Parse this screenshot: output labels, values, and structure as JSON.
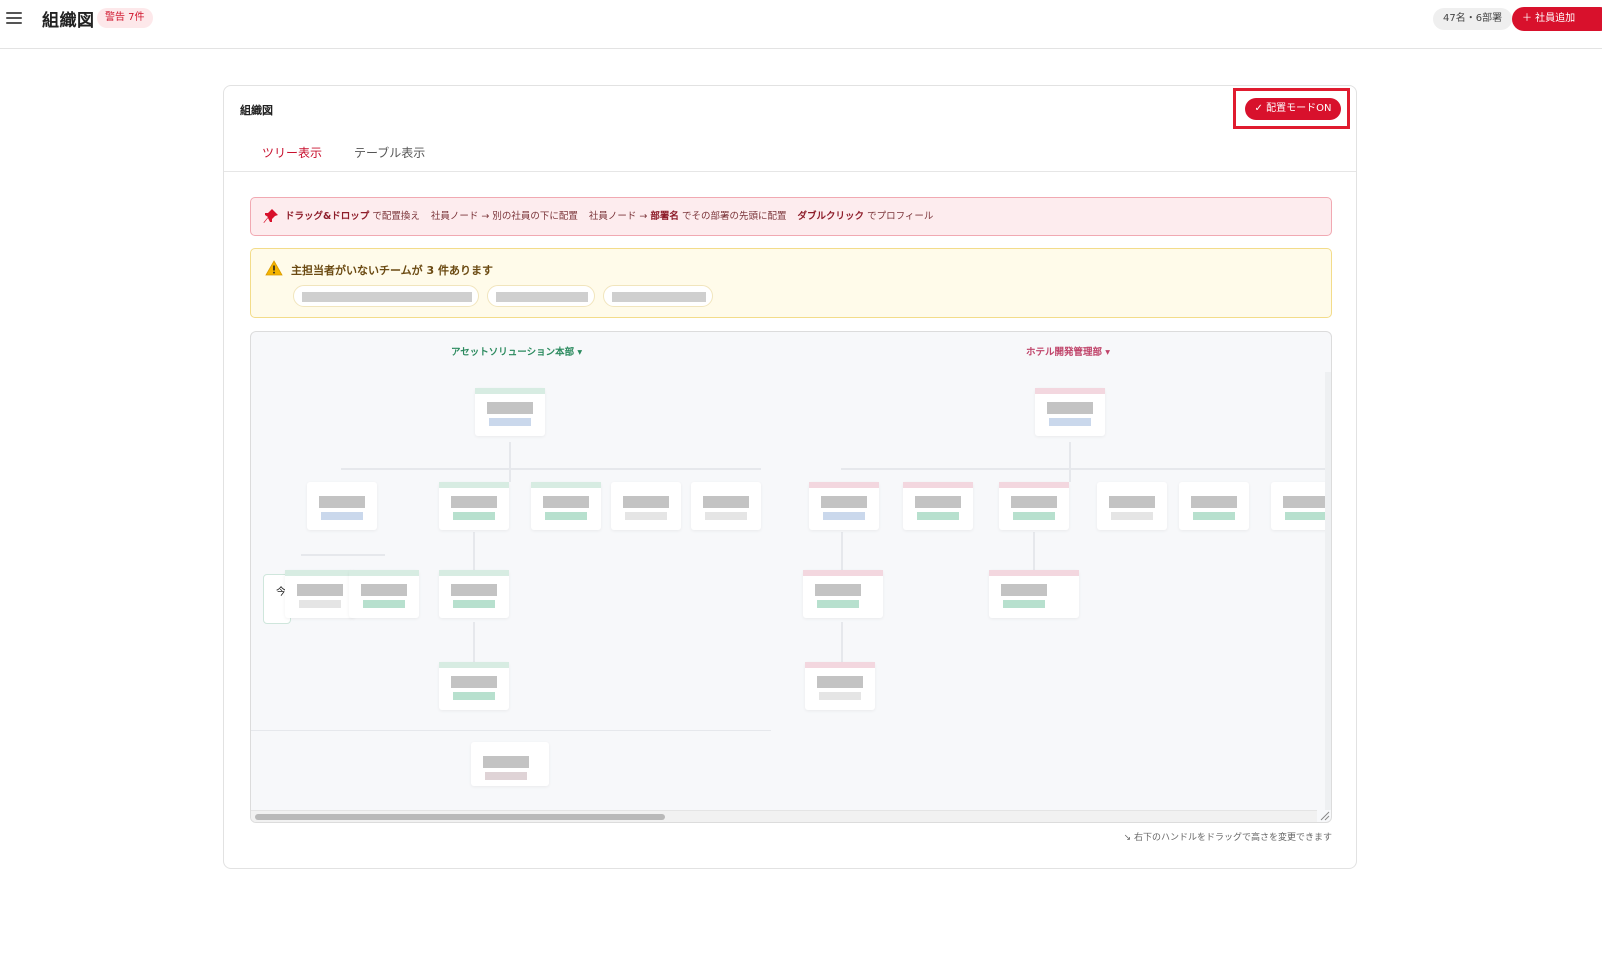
{
  "header": {
    "title": "組織図",
    "warning_badge": "警告 7件",
    "stats": "47名・6部署",
    "add_button": "＋ 社員追加"
  },
  "card": {
    "title": "組織図",
    "mode_button": "✓ 配置モードON",
    "tabs": [
      {
        "label": "ツリー表示",
        "active": true
      },
      {
        "label": "テーブル表示",
        "active": false
      }
    ]
  },
  "info_banner": {
    "drag_drop": "ドラッグ&ドロップ",
    "t1": "で配置換え",
    "t2": "社員ノード → 別の社員の下に配置",
    "t3": "社員ノード →",
    "dept_name": "部署名",
    "t4": "でその部署の先頭に配置",
    "double_click": "ダブルクリック",
    "t5": "でプロフィール"
  },
  "warning_banner": {
    "text": "主担当者がいないチームが 3 件あります"
  },
  "tree": {
    "departments": [
      {
        "name": "アセットソリューション本部 ▾",
        "color": "#2b8a5e"
      },
      {
        "name": "ホテル開発管理部 ▾",
        "color": "#c0446a"
      }
    ],
    "side_card_text": "今"
  },
  "footer_hint": "↘ 右下のハンドルをドラッグで高さを変更できます",
  "colors": {
    "accent": "#d8112c",
    "asset_dept": "#2b8a5e",
    "hotel_dept": "#c0446a"
  }
}
